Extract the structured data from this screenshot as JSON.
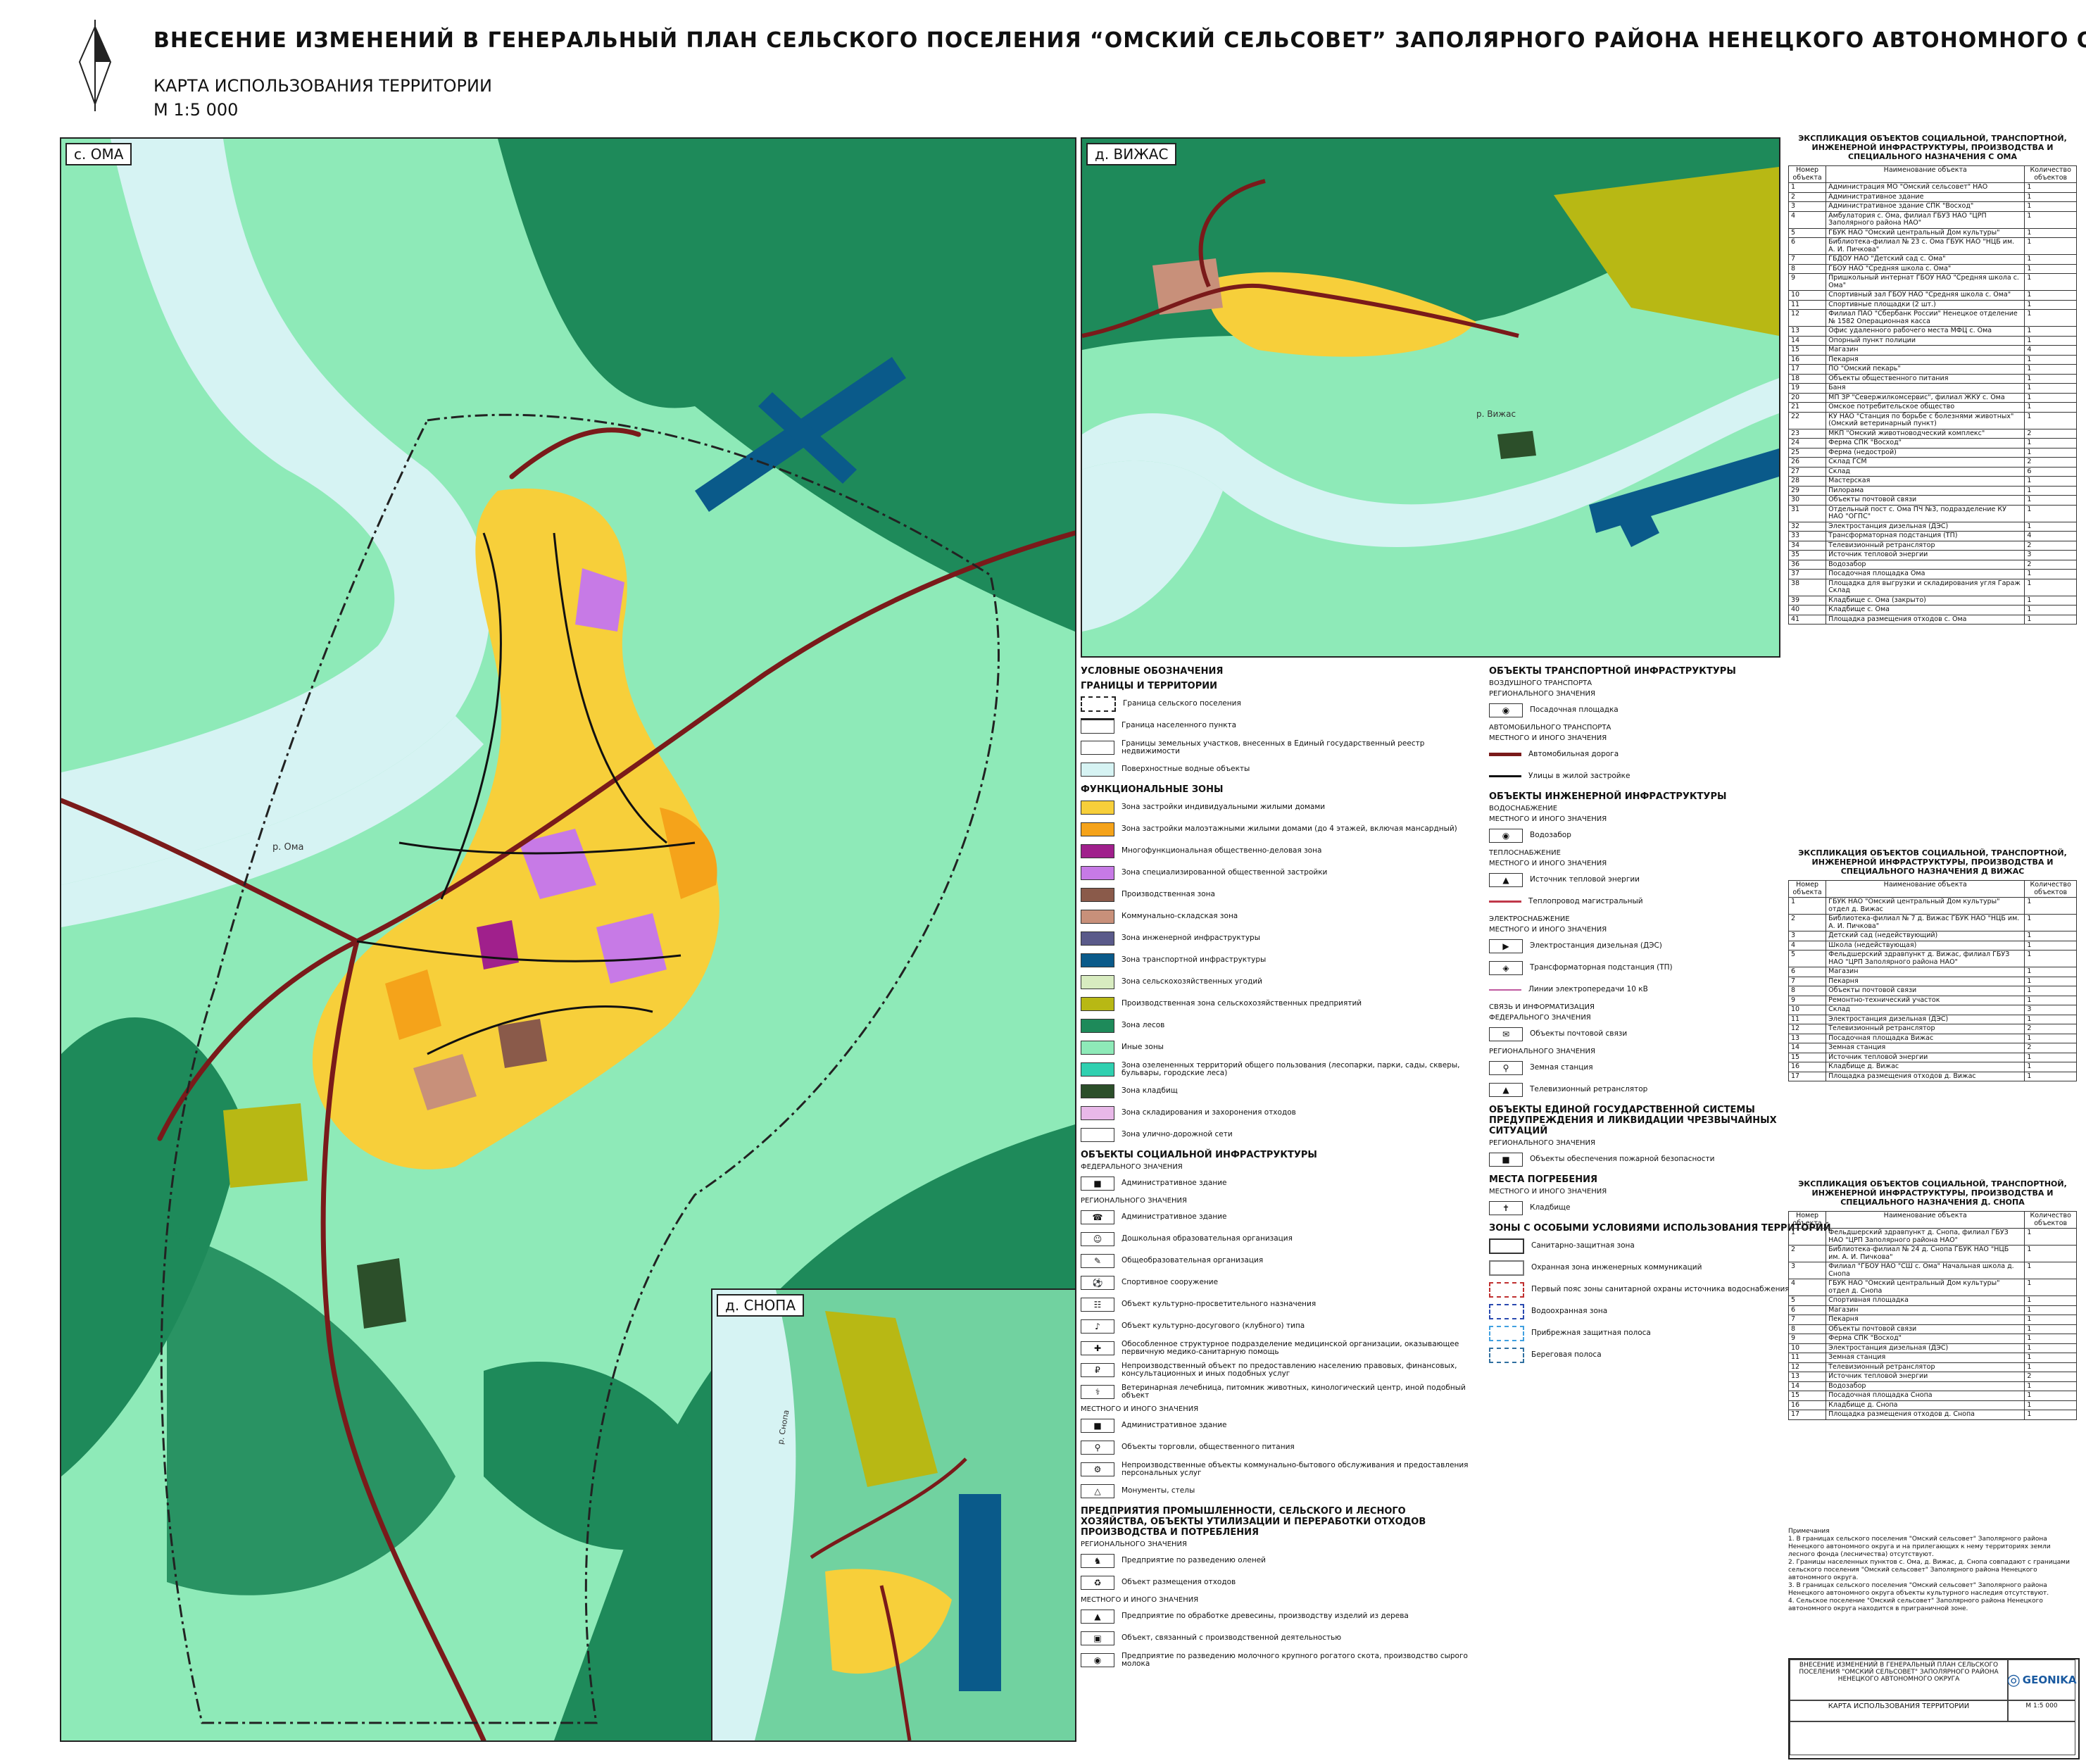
{
  "header": {
    "title": "ВНЕСЕНИЕ ИЗМЕНЕНИЙ В ГЕНЕРАЛЬНЫЙ ПЛАН СЕЛЬСКОГО ПОСЕЛЕНИЯ “ОМСКИЙ СЕЛЬСОВЕТ” ЗАПОЛЯРНОГО РАЙОНА НЕНЕЦКОГО АВТОНОМНОГО ОКРУГА",
    "subtitle": "КАРТА ИСПОЛЬЗОВАНИЯ ТЕРРИТОРИИ",
    "scale": "М 1:5 000"
  },
  "maps": {
    "oma": "с. ОМА",
    "vizhas": "д. ВИЖАС",
    "snopa": "д. СНОПА",
    "river_oma": "р. Ома",
    "river_vizhas": "р. Вижас",
    "river_snopa": "р. Снопа"
  },
  "colors": {
    "water": "#d6f3f3",
    "forest": "#1e8a5a",
    "other": "#8eeab8",
    "individual": "#f7cf3a",
    "lowrise": "#f5a31a",
    "public": "#c77ae6",
    "agri_prod": "#b8b814",
    "transport": "#0a5a8a",
    "road": "#7a1a1a",
    "cemetery": "#2c4f2a",
    "storage": "#e8b8e8"
  },
  "legend": {
    "title": "УСЛОВНЫЕ ОБОЗНАЧЕНИЯ",
    "boundaries_head": "ГРАНИЦЫ И ТЕРРИТОРИИ",
    "boundaries": [
      "Граница сельского поселения",
      "Граница населенного пункта",
      "Границы земельных участков, внесенных в Единый государственный реестр недвижимости",
      "Поверхностные водные объекты"
    ],
    "zones_head": "ФУНКЦИОНАЛЬНЫЕ ЗОНЫ",
    "zones": [
      {
        "label": "Зона застройки индивидуальными жилыми домами",
        "color": "#f7cf3a"
      },
      {
        "label": "Зона застройки малоэтажными жилыми домами (до 4 этажей, включая мансардный)",
        "color": "#f5a31a"
      },
      {
        "label": "Многофункциональная общественно-деловая зона",
        "color": "#a0208c"
      },
      {
        "label": "Зона специализированной общественной застройки",
        "color": "#c77ae6"
      },
      {
        "label": "Производственная зона",
        "color": "#8a5a4a"
      },
      {
        "label": "Коммунально-складская зона",
        "color": "#c8907a"
      },
      {
        "label": "Зона инженерной инфраструктуры",
        "color": "#5a5a8a"
      },
      {
        "label": "Зона транспортной инфраструктуры",
        "color": "#0a5a8a"
      },
      {
        "label": "Зона сельскохозяйственных угодий",
        "color": "#d8ecc0"
      },
      {
        "label": "Производственная зона сельскохозяйственных предприятий",
        "color": "#b8b814"
      },
      {
        "label": "Зона лесов",
        "color": "#1e8a5a"
      },
      {
        "label": "Иные зоны",
        "color": "#8eeab8"
      },
      {
        "label": "Зона озелененных территорий общего пользования (лесопарки, парки, сады, скверы, бульвары, городские леса)",
        "color": "#30d0b0"
      },
      {
        "label": "Зона кладбищ",
        "color": "#2c4f2a"
      },
      {
        "label": "Зона складирования и захоронения отходов",
        "color": "#e8b8e8"
      },
      {
        "label": "Зона улично-дорожной сети",
        "color": "#ffffff"
      }
    ],
    "social_head": "ОБЪЕКТЫ СОЦИАЛЬНОЙ ИНФРАСТРУКТУРЫ",
    "federal": "ФЕДЕРАЛЬНОГО ЗНАЧЕНИЯ",
    "regional": "РЕГИОНАЛЬНОГО ЗНАЧЕНИЯ",
    "local": "МЕСТНОГО И ИНОГО ЗНАЧЕНИЯ",
    "social_federal": [
      "Административное здание"
    ],
    "social_regional": [
      "Административное здание",
      "Дошкольная образовательная организация",
      "Общеобразовательная организация",
      "Спортивное сооружение",
      "Объект культурно-просветительного назначения",
      "Объект культурно-досугового (клубного) типа",
      "Обособленное структурное подразделение медицинской организации, оказывающее первичную медико-санитарную помощь",
      "Непроизводственный объект по предоставлению населению правовых, финансовых, консультационных и иных подобных услуг",
      "Ветеринарная лечебница, питомник животных, кинологический центр, иной подобный объект"
    ],
    "social_local": [
      "Административное здание",
      "Объекты торговли, общественного питания",
      "Непроизводственные объекты коммунально-бытового обслуживания и предоставления персональных услуг",
      "Монументы, стелы"
    ],
    "industry_head": "ПРЕДПРИЯТИЯ ПРОМЫШЛЕННОСТИ, СЕЛЬСКОГО И ЛЕСНОГО ХОЗЯЙСТВА, ОБЪЕКТЫ УТИЛИЗАЦИИ И ПЕРЕРАБОТКИ ОТХОДОВ ПРОИЗВОДСТВА И ПОТРЕБЛЕНИЯ",
    "industry_regional": [
      "Предприятие по разведению оленей",
      "Объект размещения отходов"
    ],
    "industry_local": [
      "Предприятие по обработке древесины, производству изделий из дерева",
      "Объект, связанный с производственной деятельностью",
      "Предприятие по разведению молочного крупного рогатого скота, производство сырого молока"
    ],
    "transport_head": "ОБЪЕКТЫ ТРАНСПОРТНОЙ ИНФРАСТРУКТУРЫ",
    "air_head": "ВОЗДУШНОГО ТРАНСПОРТА",
    "air": [
      "Посадочная площадка"
    ],
    "auto_head": "АВТОМОБИЛЬНОГО ТРАНСПОРТА",
    "auto": [
      "Автомобильная дорога",
      "Улицы в жилой застройке"
    ],
    "eng_head": "ОБЪЕКТЫ ИНЖЕНЕРНОЙ ИНФРАСТРУКТУРЫ",
    "water_head": "ВОДОСНАБЖЕНИЕ",
    "water": [
      "Водозабор"
    ],
    "heat_head": "ТЕПЛОСНАБЖЕНИЕ",
    "heat": [
      "Источник тепловой энергии",
      "Теплопровод магистральный"
    ],
    "power_head": "ЭЛЕКТРОСНАБЖЕНИЕ",
    "power": [
      "Электростанция дизельная (ДЭС)",
      "Трансформаторная подстанция (ТП)",
      "Линии электропередачи 10 кВ"
    ],
    "comm_head": "СВЯЗЬ И ИНФОРМАТИЗАЦИЯ",
    "comm_federal": [
      "Объекты почтовой связи"
    ],
    "comm_regional": [
      "Земная станция",
      "Телевизионный ретранслятор"
    ],
    "emergency_head": "ОБЪЕКТЫ ЕДИНОЙ ГОСУДАРСТВЕННОЙ СИСТЕМЫ ПРЕДУПРЕЖДЕНИЯ И ЛИКВИДАЦИИ ЧРЕЗВЫЧАЙНЫХ СИТУАЦИЙ",
    "emergency": [
      "Объекты обеспечения пожарной безопасности"
    ],
    "burial_head": "МЕСТА ПОГРЕБЕНИЯ",
    "burial": [
      "Кладбище"
    ],
    "special_head": "ЗОНЫ С ОСОБЫМИ УСЛОВИЯМИ ИСПОЛЬЗОВАНИЯ ТЕРРИТОРИЙ",
    "special": [
      "Санитарно-защитная зона",
      "Охранная зона инженерных коммуникаций",
      "Первый пояс зоны санитарной охраны источника водоснабжения",
      "Водоохранная зона",
      "Прибрежная защитная полоса",
      "Береговая полоса"
    ]
  },
  "explication": [
    {
      "title": "ЭКСПЛИКАЦИЯ ОБЪЕКТОВ СОЦИАЛЬНОЙ, ТРАНСПОРТНОЙ, ИНЖЕНЕРНОЙ ИНФРАСТРУКТУРЫ, ПРОИЗВОДСТВА И СПЕЦИАЛЬНОГО НАЗНАЧЕНИЯ С ОМА",
      "rows": [
        [
          "1",
          "Администрация МО \"Омский сельсовет\" НАО",
          "1"
        ],
        [
          "2",
          "Административное здание",
          "1"
        ],
        [
          "3",
          "Административное здание СПК \"Восход\"",
          "1"
        ],
        [
          "4",
          "Амбулатория с. Ома, филиал ГБУЗ НАО \"ЦРП Заполярного района НАО\"",
          "1"
        ],
        [
          "5",
          "ГБУК НАО \"Омский центральный Дом культуры\"",
          "1"
        ],
        [
          "6",
          "Библиотека-филиал № 23 с. Ома ГБУК НАО \"НЦБ им. А. И. Пичкова\"",
          "1"
        ],
        [
          "7",
          "ГБДОУ НАО \"Детский сад с. Ома\"",
          "1"
        ],
        [
          "8",
          "ГБОУ НАО \"Средняя школа с. Ома\"",
          "1"
        ],
        [
          "9",
          "Пришкольный интернат ГБОУ НАО \"Средняя школа с. Ома\"",
          "1"
        ],
        [
          "10",
          "Спортивный зал ГБОУ НАО \"Средняя школа с. Ома\"",
          "1"
        ],
        [
          "11",
          "Спортивные площадки (2 шт.)",
          "1"
        ],
        [
          "12",
          "Филиал ПАО \"Сбербанк России\" Ненецкое отделение № 1582 Операционная касса",
          "1"
        ],
        [
          "13",
          "Офис удаленного рабочего места МФЦ с. Ома",
          "1"
        ],
        [
          "14",
          "Опорный пункт полиции",
          "1"
        ],
        [
          "15",
          "Магазин",
          "4"
        ],
        [
          "16",
          "Пекарня",
          "1"
        ],
        [
          "17",
          "ПО \"Омский пекарь\"",
          "1"
        ],
        [
          "18",
          "Объекты общественного питания",
          "1"
        ],
        [
          "19",
          "Баня",
          "1"
        ],
        [
          "20",
          "МП ЗР \"Севержилкомсервис\", филиал ЖКУ с. Ома",
          "1"
        ],
        [
          "21",
          "Омское потребительское общество",
          "1"
        ],
        [
          "22",
          "КУ НАО \"Станция по борьбе с болезнями животных\" (Омский ветеринарный пункт)",
          "1"
        ],
        [
          "23",
          "МКП \"Омский животноводческий комплекс\"",
          "2"
        ],
        [
          "24",
          "Ферма СПК \"Восход\"",
          "1"
        ],
        [
          "25",
          "Ферма (недострой)",
          "1"
        ],
        [
          "26",
          "Склад ГСМ",
          "2"
        ],
        [
          "27",
          "Склад",
          "6"
        ],
        [
          "28",
          "Мастерская",
          "1"
        ],
        [
          "29",
          "Пилорама",
          "1"
        ],
        [
          "30",
          "Объекты почтовой связи",
          "1"
        ],
        [
          "31",
          "Отдельный пост с. Ома ПЧ №3, подразделение КУ НАО \"ОГПС\"",
          "1"
        ],
        [
          "32",
          "Электростанция дизельная (ДЭС)",
          "1"
        ],
        [
          "33",
          "Трансформаторная подстанция (ТП)",
          "4"
        ],
        [
          "34",
          "Телевизионный ретранслятор",
          "2"
        ],
        [
          "35",
          "Источник тепловой энергии",
          "3"
        ],
        [
          "36",
          "Водозабор",
          "2"
        ],
        [
          "37",
          "Посадочная площадка Ома",
          "1"
        ],
        [
          "38",
          "Площадка для выгрузки и складирования угля Гараж Склад",
          "1"
        ],
        [
          "39",
          "Кладбище с. Ома (закрыто)",
          "1"
        ],
        [
          "40",
          "Кладбище с. Ома",
          "1"
        ],
        [
          "41",
          "Площадка размещения отходов с. Ома",
          "1"
        ]
      ]
    },
    {
      "title": "ЭКСПЛИКАЦИЯ ОБЪЕКТОВ СОЦИАЛЬНОЙ, ТРАНСПОРТНОЙ, ИНЖЕНЕРНОЙ ИНФРАСТРУКТУРЫ, ПРОИЗВОДСТВА И СПЕЦИАЛЬНОГО НАЗНАЧЕНИЯ Д ВИЖАС",
      "rows": [
        [
          "1",
          "ГБУК НАО \"Омский центральный Дом культуры\" отдел д. Вижас",
          "1"
        ],
        [
          "2",
          "Библиотека-филиал № 7 д. Вижас ГБУК НАО \"НЦБ им. А. И. Пичкова\"",
          "1"
        ],
        [
          "3",
          "Детский сад (недействующий)",
          "1"
        ],
        [
          "4",
          "Школа (недействующая)",
          "1"
        ],
        [
          "5",
          "Фельдшерский здравпункт д. Вижас, филиал ГБУЗ НАО \"ЦРП Заполярного района НАО\"",
          "1"
        ],
        [
          "6",
          "Магазин",
          "1"
        ],
        [
          "7",
          "Пекарня",
          "1"
        ],
        [
          "8",
          "Объекты почтовой связи",
          "1"
        ],
        [
          "9",
          "Ремонтно-технический участок",
          "1"
        ],
        [
          "10",
          "Склад",
          "3"
        ],
        [
          "11",
          "Электростанция дизельная (ДЭС)",
          "1"
        ],
        [
          "12",
          "Телевизионный ретранслятор",
          "2"
        ],
        [
          "13",
          "Посадочная площадка Вижас",
          "1"
        ],
        [
          "14",
          "Земная станция",
          "2"
        ],
        [
          "15",
          "Источник тепловой энергии",
          "1"
        ],
        [
          "16",
          "Кладбище д. Вижас",
          "1"
        ],
        [
          "17",
          "Площадка размещения отходов д. Вижас",
          "1"
        ]
      ]
    },
    {
      "title": "ЭКСПЛИКАЦИЯ ОБЪЕКТОВ СОЦИАЛЬНОЙ, ТРАНСПОРТНОЙ, ИНЖЕНЕРНОЙ ИНФРАСТРУКТУРЫ, ПРОИЗВОДСТВА И СПЕЦИАЛЬНОГО НАЗНАЧЕНИЯ Д. СНОПА",
      "rows": [
        [
          "1",
          "Фельдшерский здравпункт д. Снопа, филиал ГБУЗ НАО \"ЦРП Заполярного района НАО\"",
          "1"
        ],
        [
          "2",
          "Библиотека-филиал № 24 д. Снопа ГБУК НАО \"НЦБ им. А. И. Пичкова\"",
          "1"
        ],
        [
          "3",
          "Филиал \"ГБОУ НАО \"СШ с. Ома\" Начальная школа д. Снопа",
          "1"
        ],
        [
          "4",
          "ГБУК НАО \"Омский центральный Дом культуры\" отдел д. Снопа",
          "1"
        ],
        [
          "5",
          "Спортивная площадка",
          "1"
        ],
        [
          "6",
          "Магазин",
          "1"
        ],
        [
          "7",
          "Пекарня",
          "1"
        ],
        [
          "8",
          "Объекты почтовой связи",
          "1"
        ],
        [
          "9",
          "Ферма СПК \"Восход\"",
          "1"
        ],
        [
          "10",
          "Электростанция дизельная (ДЭС)",
          "1"
        ],
        [
          "11",
          "Земная станция",
          "1"
        ],
        [
          "12",
          "Телевизионный ретранслятор",
          "1"
        ],
        [
          "13",
          "Источник тепловой энергии",
          "2"
        ],
        [
          "14",
          "Водозабор",
          "1"
        ],
        [
          "15",
          "Посадочная площадка Снопа",
          "1"
        ],
        [
          "16",
          "Кладбище д. Снопа",
          "1"
        ],
        [
          "17",
          "Площадка размещения отходов д. Снопа",
          "1"
        ]
      ]
    }
  ],
  "table_headers": {
    "num": "Номер объекта",
    "name": "Наименование объекта",
    "qty": "Количество объектов"
  },
  "notes": {
    "title": "Примечания",
    "items": [
      "1. В границах сельского поселения \"Омский сельсовет\" Заполярного района Ненецкого автономного округа и на прилегающих к нему территориях земли лесного фонда (лесничества) отсутствуют.",
      "2. Границы населенных пунктов с. Ома, д. Вижас, д. Снопа совпадают с границами сельского поселения \"Омский сельсовет\" Заполярного района Ненецкого автономного округа.",
      "3. В границах сельского поселения \"Омский сельсовет\" Заполярного района Ненецкого автономного округа объекты культурного наследия отсутствуют.",
      "4. Сельское поселение \"Омский сельсовет\" Заполярного района Ненецкого автономного округа находится в приграничной зоне."
    ]
  },
  "stamp": {
    "project": "ВНЕСЕНИЕ ИЗМЕНЕНИЙ В ГЕНЕРАЛЬНЫЙ ПЛАН СЕЛЬСКОГО ПОСЕЛЕНИЯ \"ОМСКИЙ СЕЛЬСОВЕТ\" ЗАПОЛЯРНОГО РАЙОНА НЕНЕЦКОГО АВТОНОМНОГО ОКРУГА",
    "company": "GEONIKA",
    "sheet": "КАРТА ИСПОЛЬЗОВАНИЯ ТЕРРИТОРИИ",
    "scale": "М 1:5 000"
  }
}
